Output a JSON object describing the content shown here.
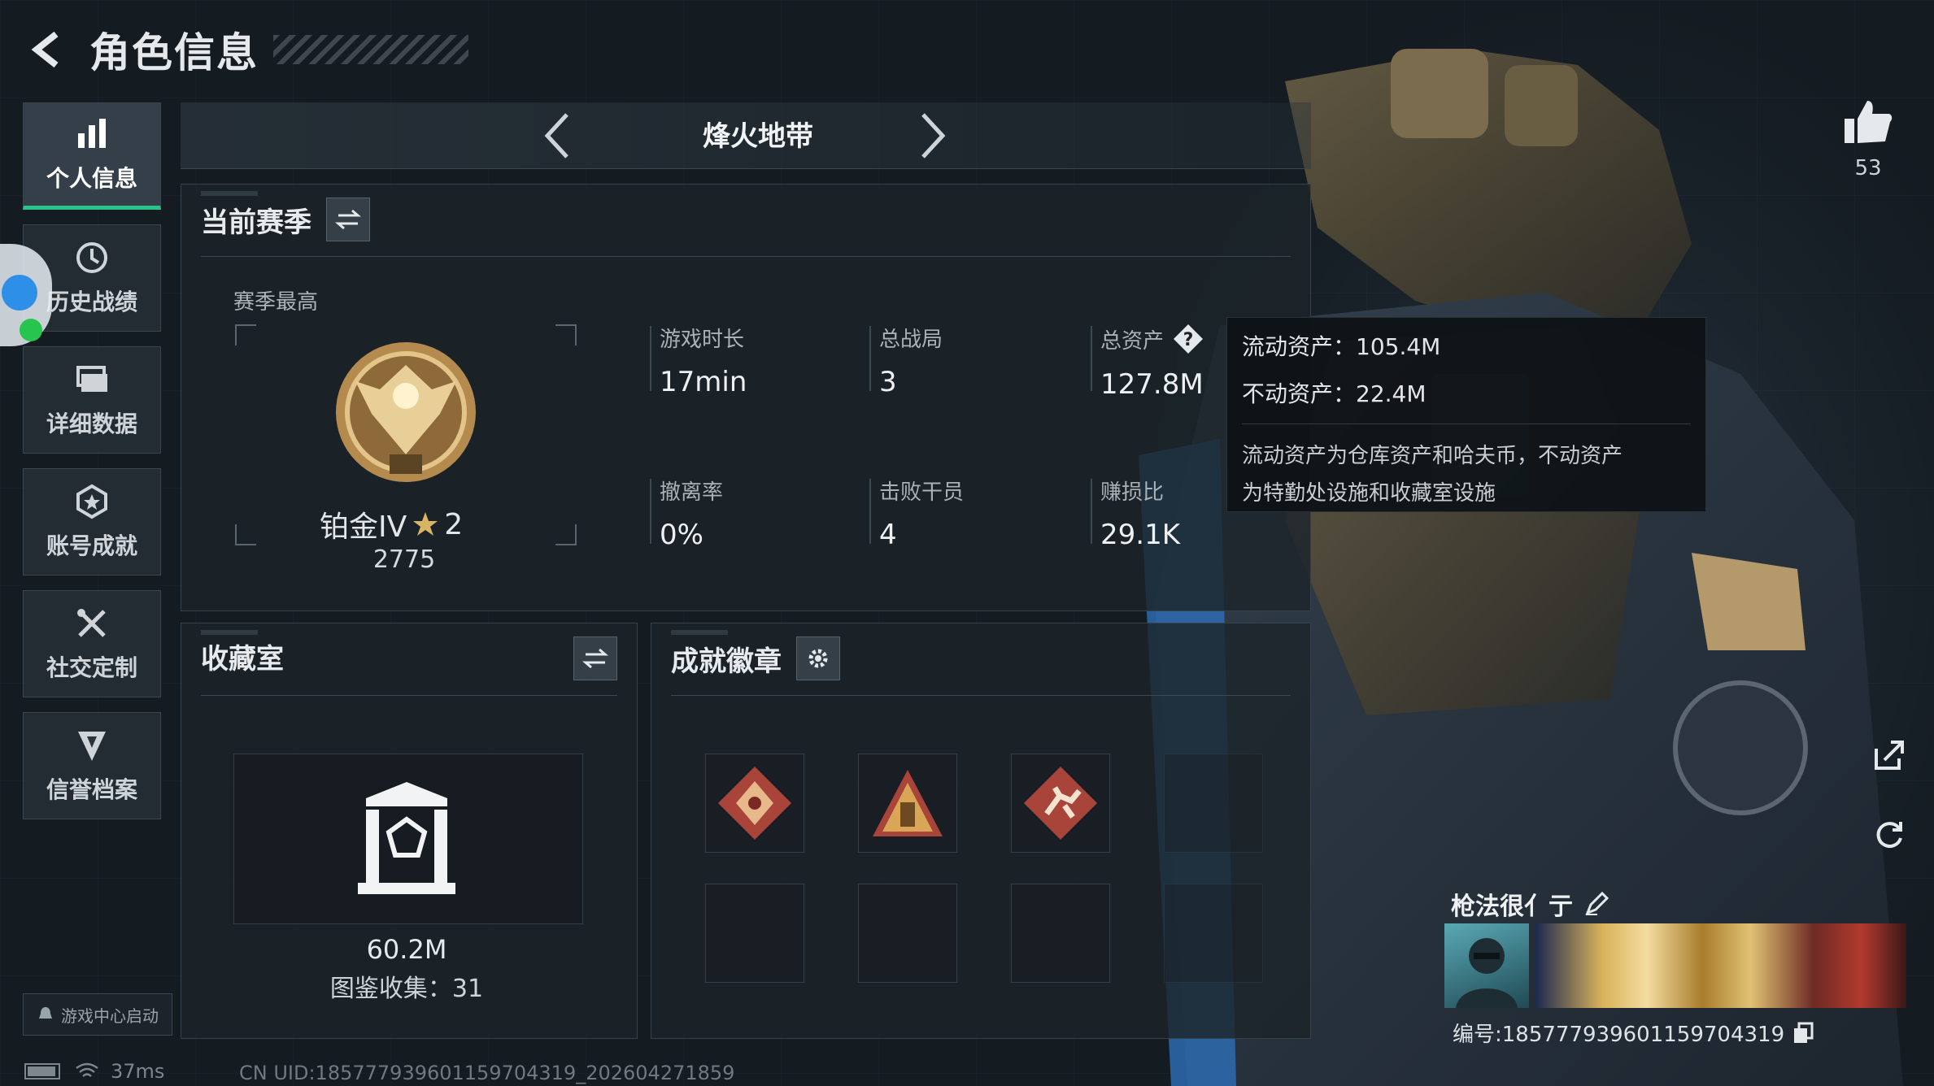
{
  "header": {
    "title": "角色信息"
  },
  "sidebar": {
    "items": [
      {
        "label": "个人信息",
        "icon": "bar-chart-icon",
        "active": true
      },
      {
        "label": "历史战绩",
        "icon": "history-clock-icon"
      },
      {
        "label": "详细数据",
        "icon": "folder-stack-icon"
      },
      {
        "label": "账号成就",
        "icon": "achievement-star-icon"
      },
      {
        "label": "社交定制",
        "icon": "tools-cross-icon"
      },
      {
        "label": "信誉档案",
        "icon": "credit-shield-icon"
      }
    ],
    "game_center_button": "游戏中心启动"
  },
  "mode": {
    "title": "烽火地带"
  },
  "season": {
    "title": "当前赛季",
    "best_label": "赛季最高",
    "rank": {
      "name": "铂金IV",
      "stars": "2",
      "score": "2775"
    },
    "stats": [
      {
        "label": "游戏时长",
        "value": "17min"
      },
      {
        "label": "总战局",
        "value": "3"
      },
      {
        "label": "总资产",
        "value": "127.8M"
      },
      {
        "label": "撤离率",
        "value": "0%"
      },
      {
        "label": "击败干员",
        "value": "4"
      },
      {
        "label": "赚损比",
        "value": "29.1K"
      }
    ]
  },
  "tooltip": {
    "liquid": "流动资产：105.4M",
    "fixed": "不动资产：22.4M",
    "desc_line1": "流动资产为仓库资产和哈夫币，不动资产",
    "desc_line2": "为特勤处设施和收藏室设施"
  },
  "collection": {
    "title": "收藏室",
    "value": "60.2M",
    "count": "图鉴收集：31"
  },
  "badges": {
    "title": "成就徽章",
    "filled_count": 3,
    "total_slots": 8
  },
  "profile": {
    "likes": "53",
    "nickname": "枪法很亻亍",
    "id_text": "编号:18577793960115970431​9"
  },
  "status": {
    "ping": "37ms",
    "uid": "CN UID:18577793960115970431​9_202604271859"
  },
  "colors": {
    "accent": "#29c48a",
    "panel": "#1c242a",
    "badge_red": "#a8443a",
    "gold": "#c9a45a"
  }
}
